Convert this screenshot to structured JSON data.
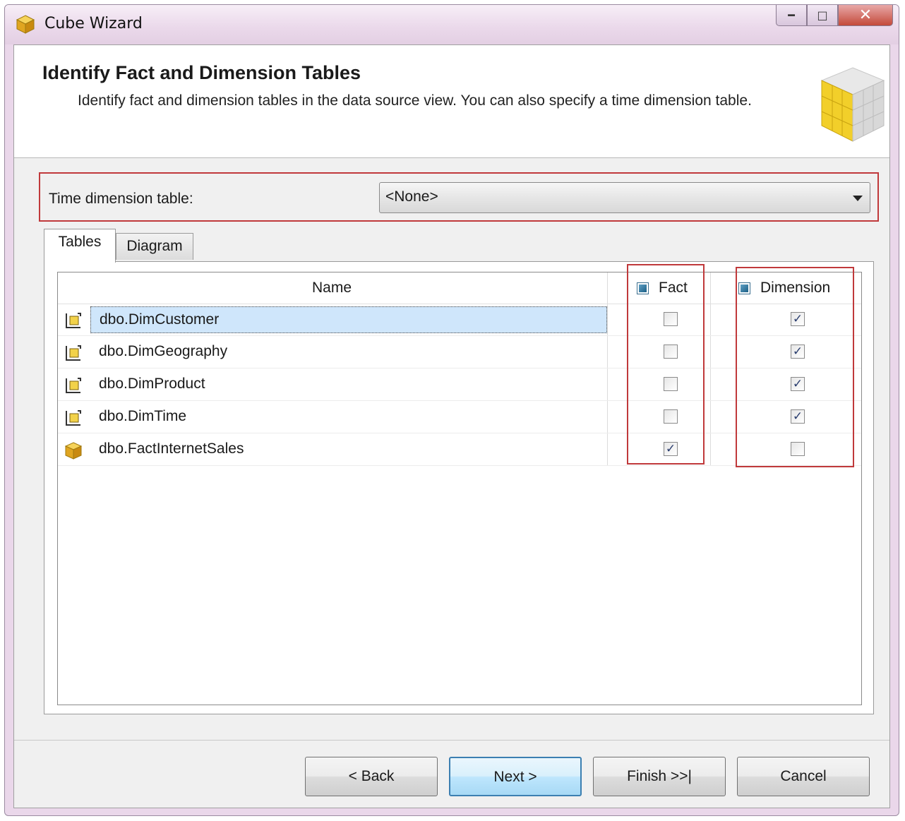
{
  "window": {
    "title": "Cube Wizard"
  },
  "header": {
    "title": "Identify Fact and Dimension Tables",
    "subtitle": "Identify fact and dimension tables in the data source view. You can also specify a time dimension table."
  },
  "time_dimension": {
    "label": "Time dimension table:",
    "value": "<None>"
  },
  "tabs": [
    {
      "label": "Tables",
      "active": true
    },
    {
      "label": "Diagram",
      "active": false
    }
  ],
  "grid": {
    "columns": {
      "name": "Name",
      "fact": "Fact",
      "dimension": "Dimension"
    },
    "rows": [
      {
        "name": "dbo.DimCustomer",
        "icon": "dimension-table-icon",
        "fact": false,
        "dimension": true,
        "selected": true
      },
      {
        "name": "dbo.DimGeography",
        "icon": "dimension-table-icon",
        "fact": false,
        "dimension": true,
        "selected": false
      },
      {
        "name": "dbo.DimProduct",
        "icon": "dimension-table-icon",
        "fact": false,
        "dimension": true,
        "selected": false
      },
      {
        "name": "dbo.DimTime",
        "icon": "dimension-table-icon",
        "fact": false,
        "dimension": true,
        "selected": false
      },
      {
        "name": "dbo.FactInternetSales",
        "icon": "fact-cube-icon",
        "fact": true,
        "dimension": false,
        "selected": false
      }
    ]
  },
  "buttons": {
    "back": "< Back",
    "next": "Next >",
    "finish": "Finish >>|",
    "cancel": "Cancel"
  },
  "colors": {
    "highlight_border": "#c0393b",
    "selection": "#cfe6fb"
  }
}
